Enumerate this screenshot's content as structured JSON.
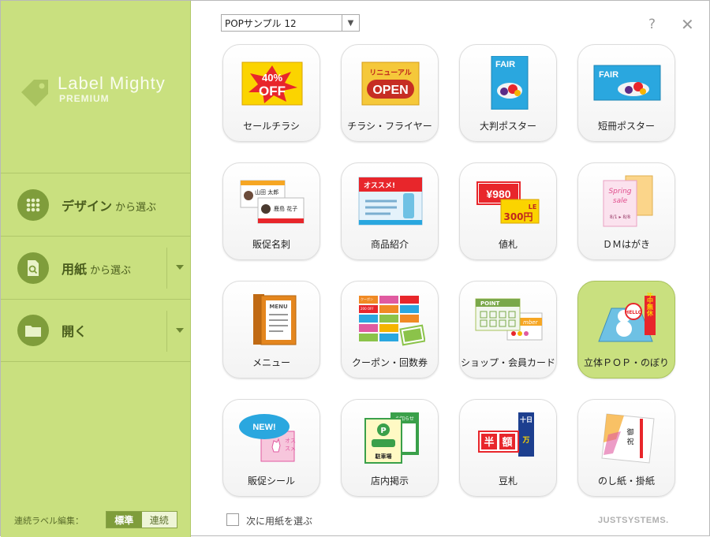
{
  "app": {
    "name": "Label Mighty",
    "edition": "PREMIUM",
    "vendor": "JUSTSYSTEMS."
  },
  "sidebar": {
    "items": [
      {
        "label": "デザイン",
        "suffix": "から選ぶ",
        "icon": "grid-icon",
        "has_dropdown": false
      },
      {
        "label": "用紙",
        "suffix": "から選ぶ",
        "icon": "paper-search-icon",
        "has_dropdown": true
      },
      {
        "label": "開く",
        "suffix": "",
        "icon": "folder-icon",
        "has_dropdown": true
      }
    ],
    "continuous_label": "連続ラベル編集：",
    "mode_options": [
      "標準",
      "連続"
    ],
    "mode_selected": "標準"
  },
  "toolbar": {
    "selected_sample": "POPサンプル 12",
    "help": "?",
    "close": "✕"
  },
  "tiles": [
    {
      "caption": "セールチラシ",
      "art_text": [
        "40%",
        "OFF"
      ],
      "icon": "sale-flyer-icon"
    },
    {
      "caption": "チラシ・フライヤー",
      "art_text": [
        "リニューアル",
        "OPEN"
      ],
      "icon": "flyer-icon"
    },
    {
      "caption": "大判ポスター",
      "art_text": [
        "FAIR"
      ],
      "icon": "large-poster-icon"
    },
    {
      "caption": "短冊ポスター",
      "art_text": [
        "FAIR"
      ],
      "icon": "strip-poster-icon"
    },
    {
      "caption": "販促名刺",
      "art_text": [
        "山田 太郎",
        "鹿島 花子"
      ],
      "icon": "business-card-icon"
    },
    {
      "caption": "商品紹介",
      "art_text": [
        "オススメ!"
      ],
      "icon": "product-intro-icon"
    },
    {
      "caption": "値札",
      "art_text": [
        "¥980",
        "300円",
        "LE"
      ],
      "icon": "price-tag-icon"
    },
    {
      "caption": "ＤＭはがき",
      "art_text": [
        "Spring",
        "sale",
        "8/1 ▸ 8/8"
      ],
      "icon": "dm-postcard-icon"
    },
    {
      "caption": "メニュー",
      "art_text": [
        "MENU"
      ],
      "icon": "menu-icon"
    },
    {
      "caption": "クーポン・回数券",
      "art_text": [
        "クーポン",
        "200 OFF"
      ],
      "icon": "coupon-icon"
    },
    {
      "caption": "ショップ・会員カード",
      "art_text": [
        "POINT",
        "mber"
      ],
      "icon": "member-card-icon"
    },
    {
      "caption": "立体ＰＯＰ・のぼり",
      "art_text": [
        "HELLO",
        "年中無休"
      ],
      "icon": "standing-pop-icon"
    },
    {
      "caption": "販促シール",
      "art_text": [
        "NEW!",
        "オス",
        "スメ"
      ],
      "icon": "sticker-icon"
    },
    {
      "caption": "店内掲示",
      "art_text": [
        "P",
        "駐車場",
        "お知らせ"
      ],
      "icon": "store-notice-icon"
    },
    {
      "caption": "豆札",
      "art_text": [
        "半",
        "額",
        "十日",
        "万"
      ],
      "icon": "small-tag-icon"
    },
    {
      "caption": "のし紙・掛紙",
      "art_text": [
        "御",
        "祝"
      ],
      "icon": "noshi-icon"
    }
  ],
  "selected_tile": 11,
  "footer": {
    "next_paper_label": "次に用紙を選ぶ",
    "next_paper_checked": false
  },
  "colors": {
    "sidebar": "#c9e07f",
    "accent": "#7f9d3b",
    "selected_tile": "#c9e07f"
  }
}
